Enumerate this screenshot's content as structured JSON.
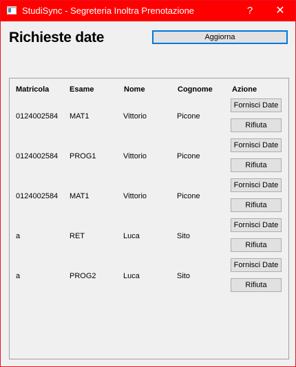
{
  "window": {
    "title": "StudiSync - Segreteria Inoltra Prenotazione",
    "help_label": "?",
    "close_label": "✕"
  },
  "colors": {
    "titlebar": "#ff0000",
    "window_bg": "#f0f0f0",
    "focus_border": "#0078d7"
  },
  "page": {
    "title": "Richieste date",
    "refresh_label": "Aggiorna"
  },
  "table": {
    "headers": [
      "Matricola",
      "Esame",
      "Nome",
      "Cognome",
      "Azione"
    ],
    "rows": [
      {
        "matricola": "0124002584",
        "esame": "MAT1",
        "nome": "Vittorio",
        "cognome": "Picone",
        "provide_label": "Fornisci Date",
        "reject_label": "Rifiuta"
      },
      {
        "matricola": "0124002584",
        "esame": "PROG1",
        "nome": "Vittorio",
        "cognome": "Picone",
        "provide_label": "Fornisci Date",
        "reject_label": "Rifiuta"
      },
      {
        "matricola": "0124002584",
        "esame": "MAT1",
        "nome": "Vittorio",
        "cognome": "Picone",
        "provide_label": "Fornisci Date",
        "reject_label": "Rifiuta"
      },
      {
        "matricola": "a",
        "esame": "RET",
        "nome": "Luca",
        "cognome": "Sito",
        "provide_label": "Fornisci Date",
        "reject_label": "Rifiuta"
      },
      {
        "matricola": "a",
        "esame": "PROG2",
        "nome": "Luca",
        "cognome": "Sito",
        "provide_label": "Fornisci Date",
        "reject_label": "Rifiuta"
      }
    ]
  }
}
